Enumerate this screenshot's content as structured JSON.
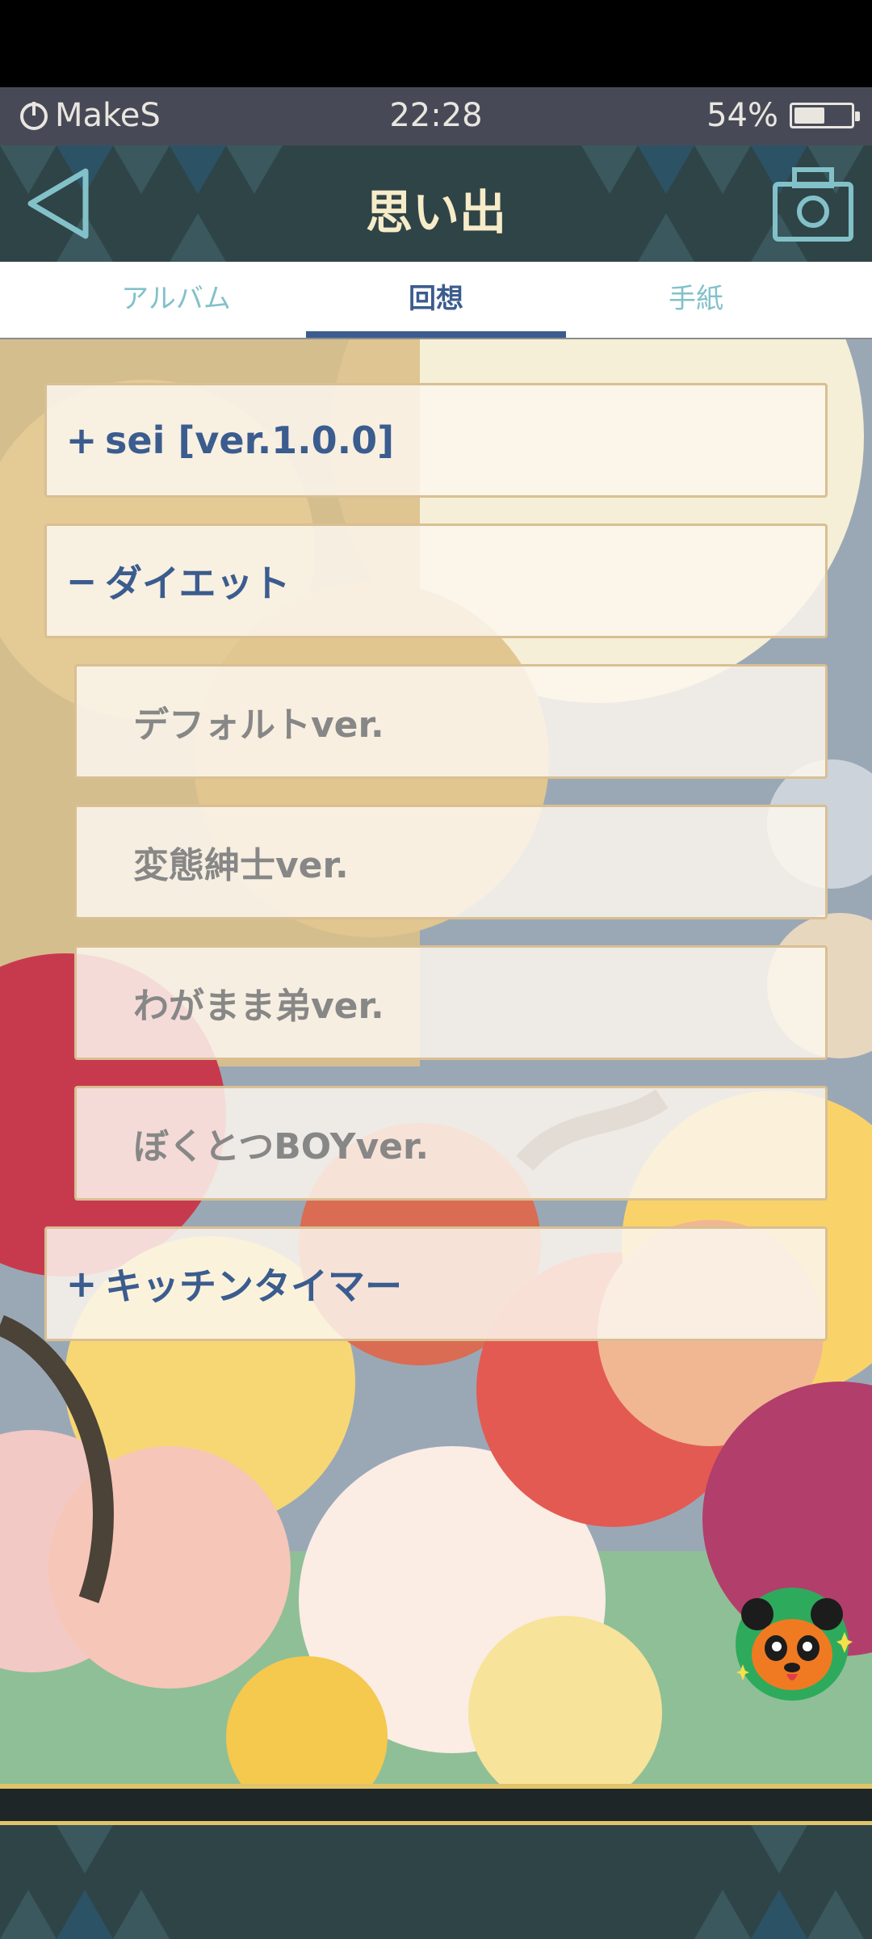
{
  "status_bar": {
    "carrier": "MakeS",
    "time": "22:28",
    "battery_percent_label": "54%",
    "battery_level": 0.54
  },
  "header": {
    "title": "思い出",
    "back_icon": "back-triangle-icon",
    "camera_icon": "camera-icon"
  },
  "tabs": [
    {
      "label": "アルバム",
      "active": false
    },
    {
      "label": "回想",
      "active": true
    },
    {
      "label": "手紙",
      "active": false
    }
  ],
  "memory_list": {
    "groups": [
      {
        "sign": "+",
        "label": "sei [ver.1.0.0]",
        "expanded": false
      },
      {
        "sign": "−",
        "label": "ダイエット",
        "expanded": true,
        "items": [
          "デフォルトver.",
          "変態紳士ver.",
          "わがまま弟ver.",
          "ぼくとつBOYver."
        ]
      },
      {
        "sign": "+",
        "label": "キッチンタイマー",
        "expanded": false
      }
    ]
  },
  "colors": {
    "accent": "#3b5c8e",
    "header_bg": "#2f4447",
    "tab_inactive": "#83c1c9",
    "status_bg": "#474a56",
    "gold": "#e0c46a"
  },
  "mascot": {
    "icon": "panda-mascot-icon"
  }
}
